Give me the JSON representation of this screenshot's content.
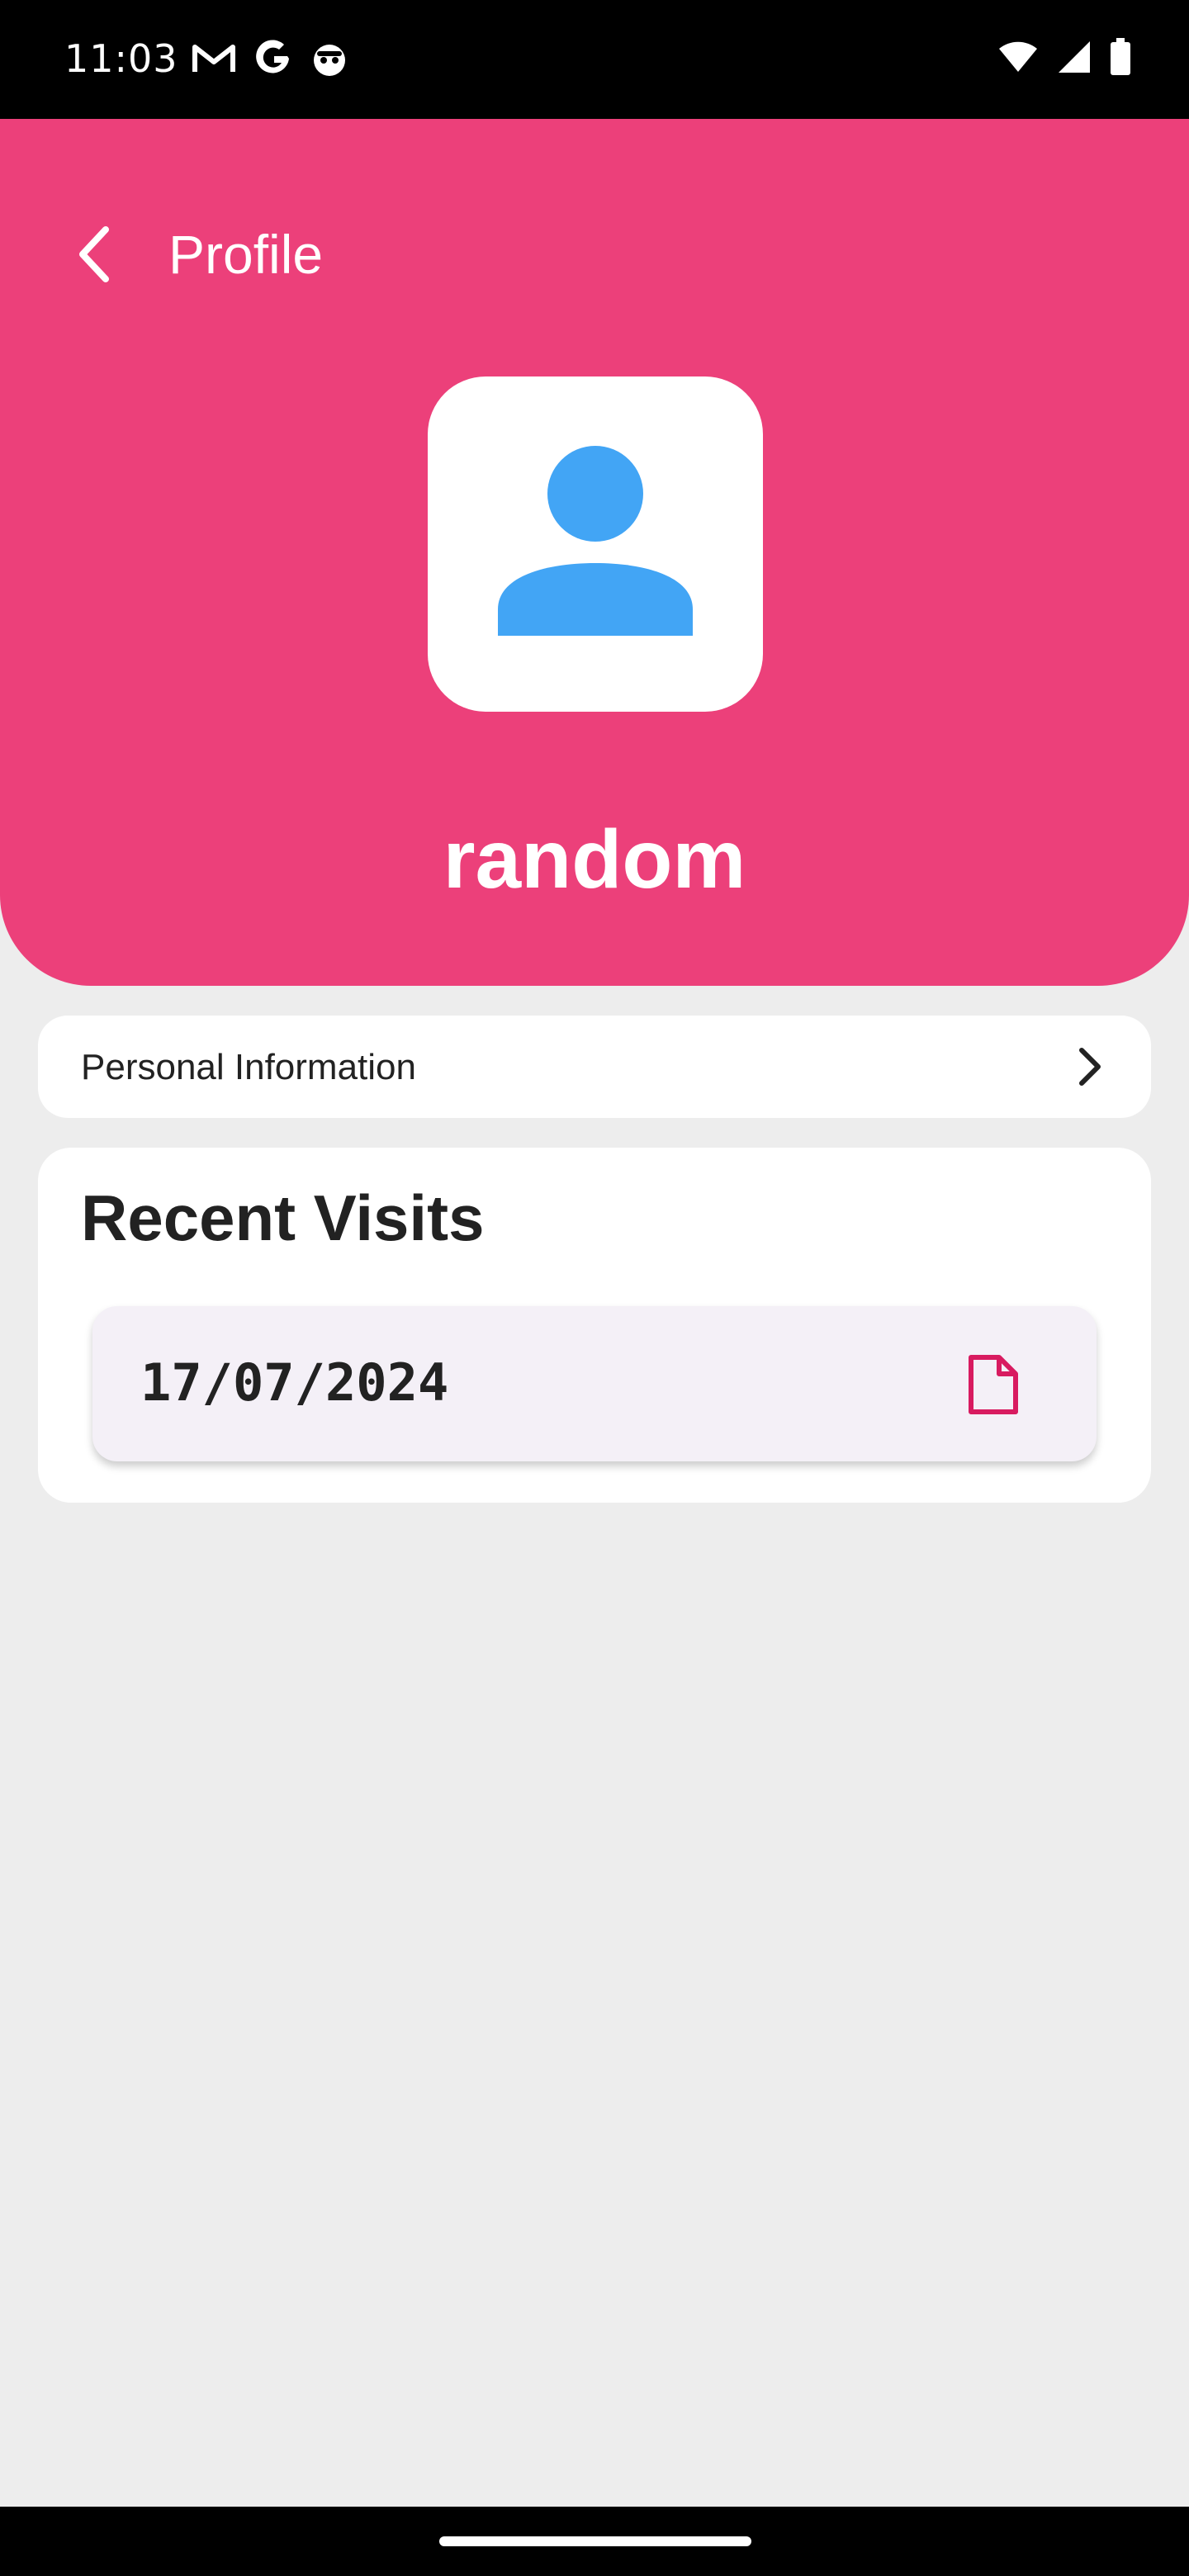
{
  "status_bar": {
    "time": "11:03",
    "left_icons": [
      "gmail-icon",
      "google-icon",
      "robot-icon"
    ],
    "right_icons": [
      "wifi-icon",
      "signal-icon",
      "battery-icon"
    ]
  },
  "header": {
    "title": "Profile",
    "back_icon": "chevron-left-icon",
    "username": "random",
    "avatar_icon": "person-icon",
    "background_color": "#EC407A",
    "avatar_color": "#42A5F5"
  },
  "personal_info": {
    "label": "Personal Information",
    "icon": "chevron-right-icon"
  },
  "recent_visits": {
    "title": "Recent Visits",
    "items": [
      {
        "date": "17/07/2024",
        "icon": "document-icon"
      }
    ]
  },
  "colors": {
    "accent": "#EC407A",
    "doc_icon": "#D81B60",
    "page_background": "#EDEDED",
    "visit_item_background": "#F4F0F7"
  }
}
